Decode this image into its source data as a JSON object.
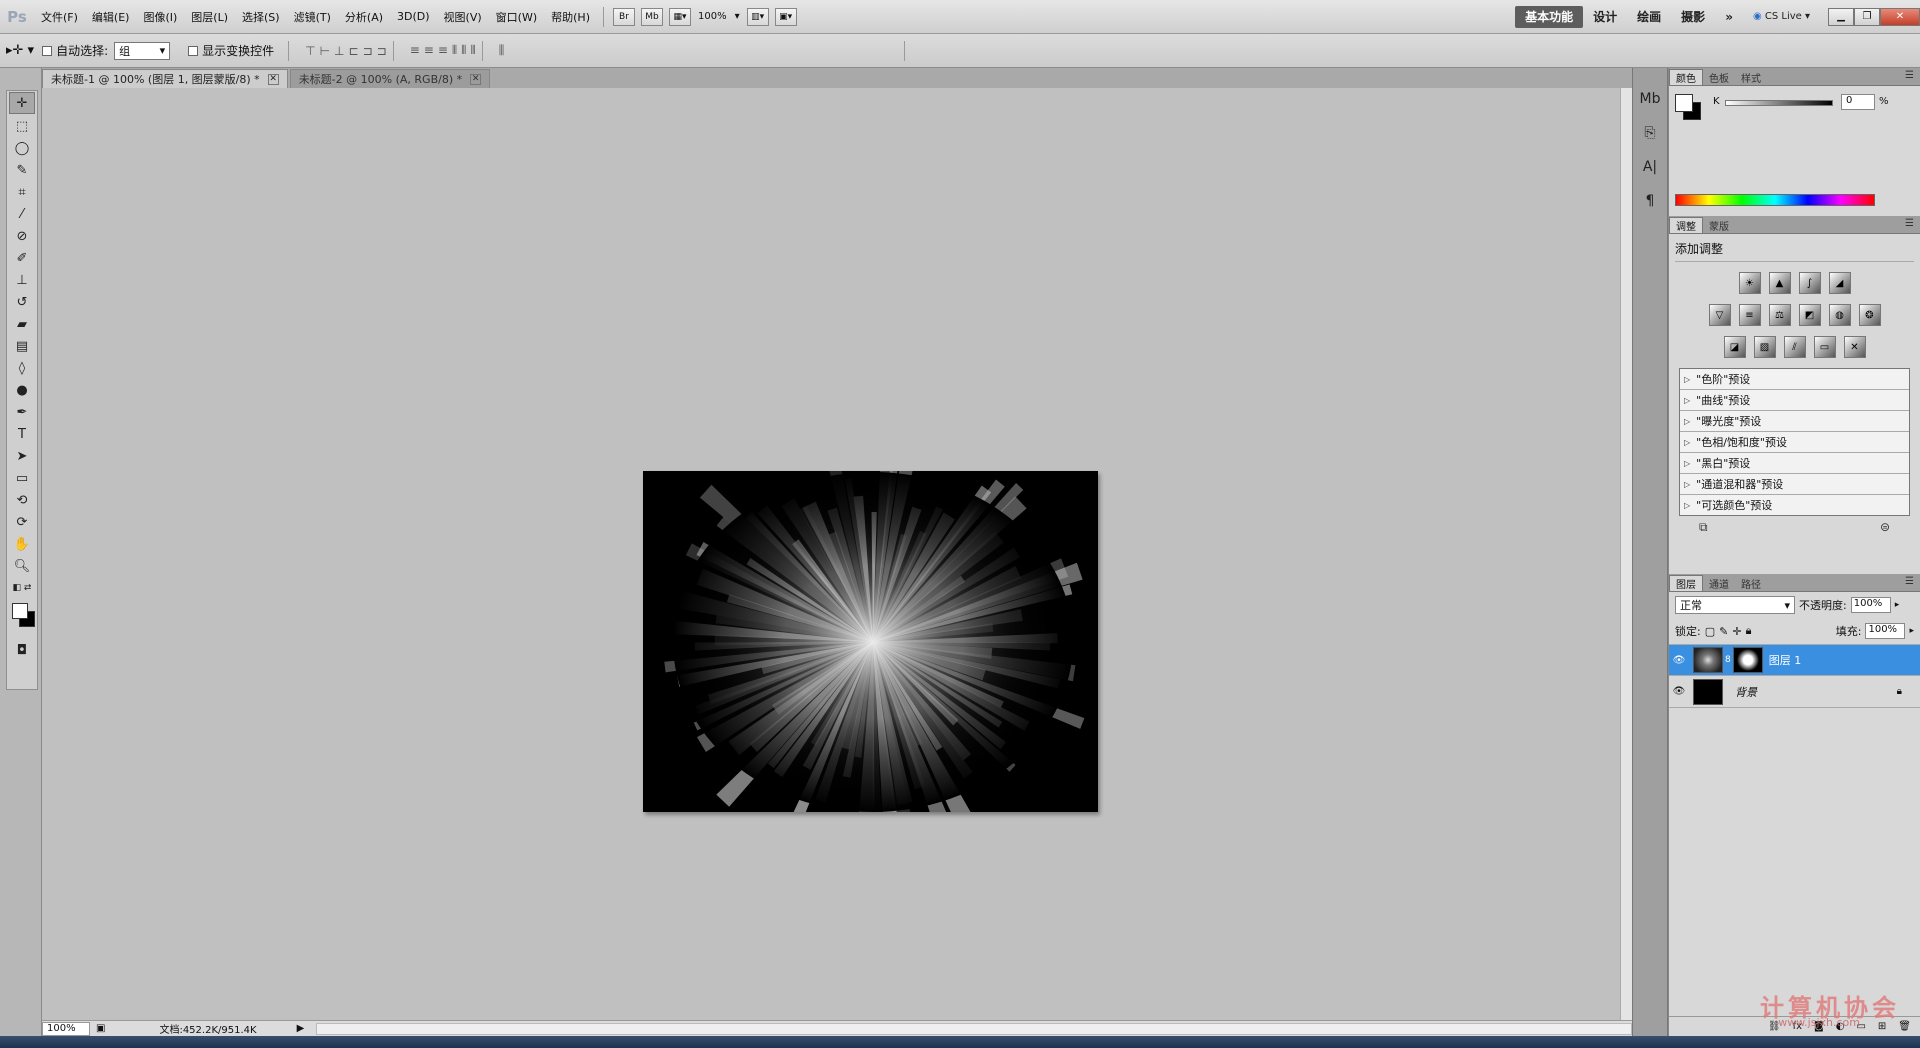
{
  "app": {
    "logo": "Ps"
  },
  "menu": [
    "文件(F)",
    "编辑(E)",
    "图像(I)",
    "图层(L)",
    "选择(S)",
    "滤镜(T)",
    "分析(A)",
    "3D(D)",
    "视图(V)",
    "窗口(W)",
    "帮助(H)"
  ],
  "menubar_buttons": {
    "bridge": "Br",
    "minibridge": "Mb",
    "zoom": "100%"
  },
  "workspaces": {
    "essentials": "基本功能",
    "design": "设计",
    "painting": "绘画",
    "photography": "摄影",
    "more": "»",
    "cslive": "CS Live"
  },
  "options": {
    "auto_select_label": "自动选择:",
    "auto_select_value": "组",
    "show_transform_label": "显示变换控件"
  },
  "tabs": [
    {
      "title": "未标题-1 @ 100% (图层 1, 图层蒙版/8) *"
    },
    {
      "title": "未标题-2 @ 100% (A, RGB/8) *"
    }
  ],
  "status": {
    "zoom": "100%",
    "doc_info": "文档:452.2K/951.4K"
  },
  "color_panel": {
    "tabs": [
      "颜色",
      "色板",
      "样式"
    ],
    "k_label": "K",
    "k_value": "0",
    "unit": "%"
  },
  "adjust_panel": {
    "tabs": [
      "调整",
      "蒙版"
    ],
    "title": "添加调整",
    "presets": [
      "\"色阶\"预设",
      "\"曲线\"预设",
      "\"曝光度\"预设",
      "\"色相/饱和度\"预设",
      "\"黑白\"预设",
      "\"通道混和器\"预设",
      "\"可选颜色\"预设"
    ]
  },
  "layers_panel": {
    "tabs": [
      "图层",
      "通道",
      "路径"
    ],
    "blend_mode": "正常",
    "opacity_label": "不透明度:",
    "opacity": "100%",
    "lock_label": "锁定:",
    "fill_label": "填充:",
    "fill": "100%",
    "layers": [
      {
        "name": "图层 1",
        "selected": true
      },
      {
        "name": "背景",
        "selected": false
      }
    ]
  },
  "watermark": {
    "text": "计算机协会",
    "sub": "www.jsjxh.com"
  }
}
